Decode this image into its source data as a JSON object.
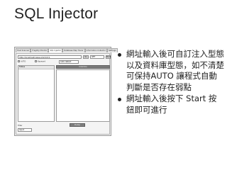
{
  "slide": {
    "title": "SQL Injector"
  },
  "app": {
    "tabs": [
      {
        "label": "Host Scanner",
        "active": false
      },
      {
        "label": "Fragility Monitor",
        "active": false
      },
      {
        "label": "SQL Injector",
        "active": true
      },
      {
        "label": "Database Map Tracer",
        "active": false
      },
      {
        "label": "Information Collector",
        "active": false
      },
      {
        "label": "Settings",
        "active": false
      }
    ],
    "url_value": "http://localhost/news.php?id=1",
    "go_label": "Go",
    "method_value": "GET",
    "start_label": "Start",
    "options": [
      {
        "label": "AUTO"
      },
      {
        "label": "Keyword"
      }
    ],
    "db_value": "Auto-detect",
    "left_header": "Tables",
    "right_header": "Columns",
    "bottom_button": "Dump",
    "bottom_label": "Filter",
    "bottom_input": "Input"
  },
  "bullets": [
    "網址輸入後可自訂注入型態以及資料庫型態，如不清楚可保持AUTO 讓程式自動判斷是否存在弱點",
    "網址輸入後按下 Start 按鈕即可進行"
  ]
}
